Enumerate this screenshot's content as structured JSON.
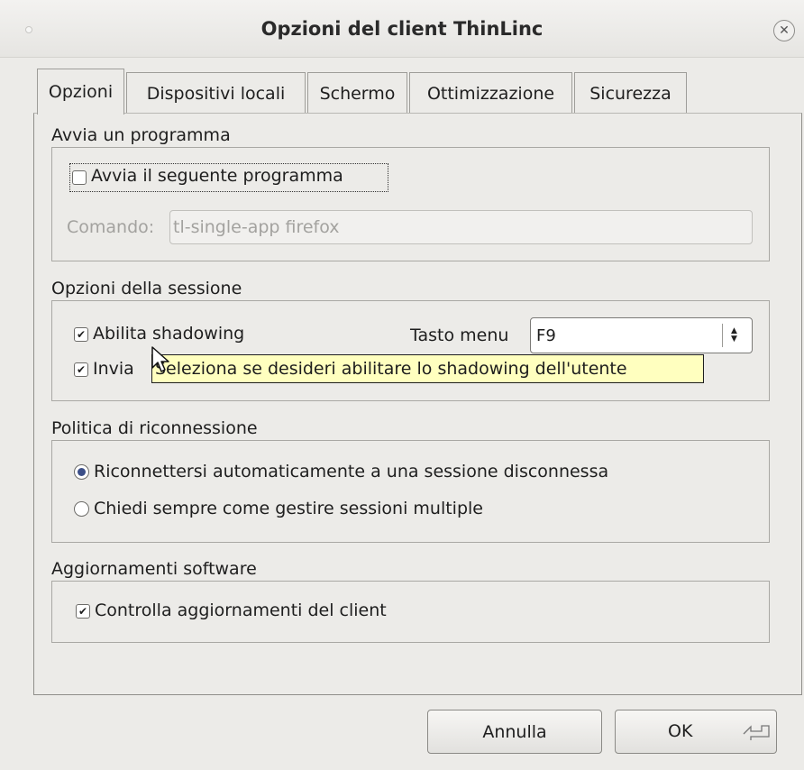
{
  "window": {
    "title": "Opzioni del client ThinLinc",
    "close_symbol": "✕"
  },
  "tabs": [
    {
      "label": "Opzioni",
      "active": true
    },
    {
      "label": "Dispositivi locali",
      "active": false
    },
    {
      "label": "Schermo",
      "active": false
    },
    {
      "label": "Ottimizzazione",
      "active": false
    },
    {
      "label": "Sicurezza",
      "active": false
    }
  ],
  "avvia": {
    "group_title": "Avvia un programma",
    "checkbox_label": "Avvia il seguente programma",
    "checked": false,
    "command_label": "Comando:",
    "command_value": "tl-single-app firefox"
  },
  "sessione": {
    "group_title": "Opzioni della sessione",
    "shadowing_label": "Abilita shadowing",
    "shadowing_checked": true,
    "invia_label": "Invia",
    "invia_checked": true,
    "menu_key_label": "Tasto menu",
    "menu_key_value": "F9",
    "tooltip": "Seleziona se desideri abilitare lo shadowing dell'utente"
  },
  "riconnessione": {
    "group_title": "Politica di riconnessione",
    "options": [
      {
        "label": "Riconnettersi automaticamente a una sessione disconnessa",
        "selected": true
      },
      {
        "label": "Chiedi sempre come gestire sessioni multiple",
        "selected": false
      }
    ]
  },
  "aggiornamenti": {
    "group_title": "Aggiornamenti software",
    "checkbox_label": "Controlla aggiornamenti del client",
    "checked": true
  },
  "buttons": {
    "cancel": "Annulla",
    "ok": "OK"
  },
  "colors": {
    "tooltip_bg": "#ffffbf",
    "radio_dot": "#3c4f88"
  }
}
